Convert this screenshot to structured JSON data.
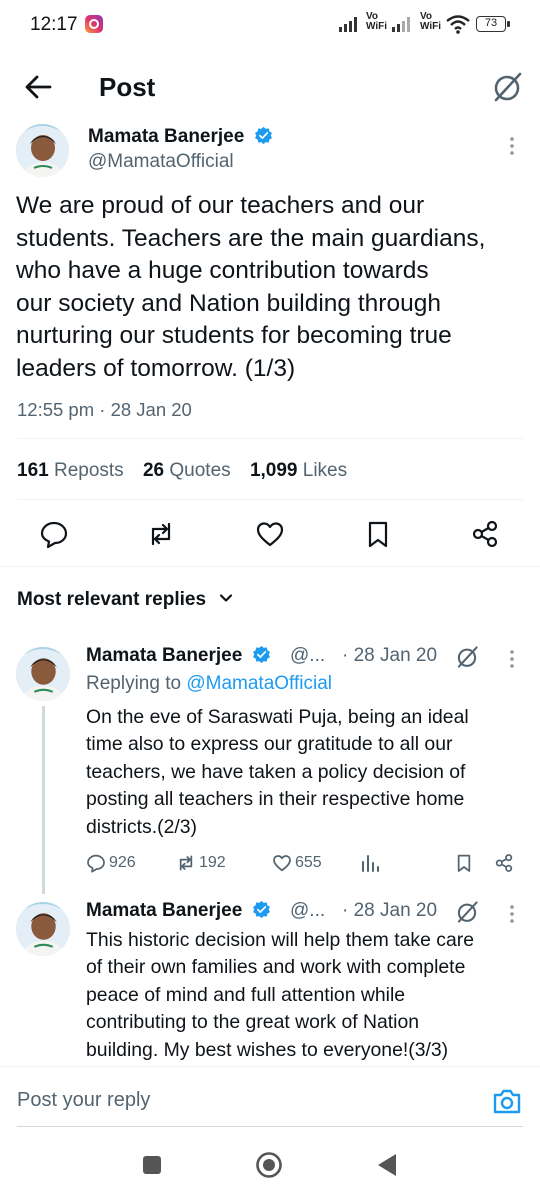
{
  "status_bar": {
    "time": "12:17",
    "vo_label": "Vo",
    "wifi_label": "WiFi",
    "battery": "73"
  },
  "header": {
    "title": "Post"
  },
  "post": {
    "author_name": "Mamata Banerjee",
    "handle": "@MamataOfficial",
    "text": "We are proud of our teachers and our students. Teachers are the main guardians, who have a huge contribution towards our society and Nation building through nurturing our students for becoming true leaders of tomorrow. (1/3)",
    "text_lines": [
      "We are proud of our teachers and our",
      "students. Teachers are the main guardians,",
      "who have a huge contribution towards",
      "our society and Nation building through",
      "nurturing our students for becoming true",
      "leaders of tomorrow. (1/3)"
    ],
    "timestamp": "12:55 pm · 28 Jan 20",
    "stats": {
      "reposts_count": "161",
      "reposts_label": "Reposts",
      "quotes_count": "26",
      "quotes_label": "Quotes",
      "likes_count": "1,099",
      "likes_label": "Likes"
    }
  },
  "replies_section": {
    "label": "Most relevant replies"
  },
  "replies": [
    {
      "author_name": "Mamata Banerjee",
      "handle": "@...",
      "date": "· 28 Jan 20",
      "replying_to_label": "Replying to",
      "replying_to_handle": "@MamataOfficial",
      "text_lines": [
        "On the eve of Saraswati Puja, being an ideal",
        "time also to express our gratitude to all our",
        "teachers, we have taken a policy decision of",
        "posting all teachers in their respective home",
        "districts.(2/3)"
      ],
      "replies_count": "926",
      "reposts_count": "192",
      "likes_count": "655"
    },
    {
      "author_name": "Mamata Banerjee",
      "handle": "@...",
      "date": "· 28 Jan 20",
      "text_lines": [
        "This historic decision will help them take care",
        "of their own families and work with complete",
        "peace of mind and full attention while",
        "contributing to the great work of Nation",
        "building. My best wishes to everyone!(3/3)"
      ]
    }
  ],
  "composer": {
    "placeholder": "Post your reply"
  },
  "colors": {
    "accent": "#1d9bf0",
    "text": "#0f1419",
    "secondary": "#536471"
  }
}
